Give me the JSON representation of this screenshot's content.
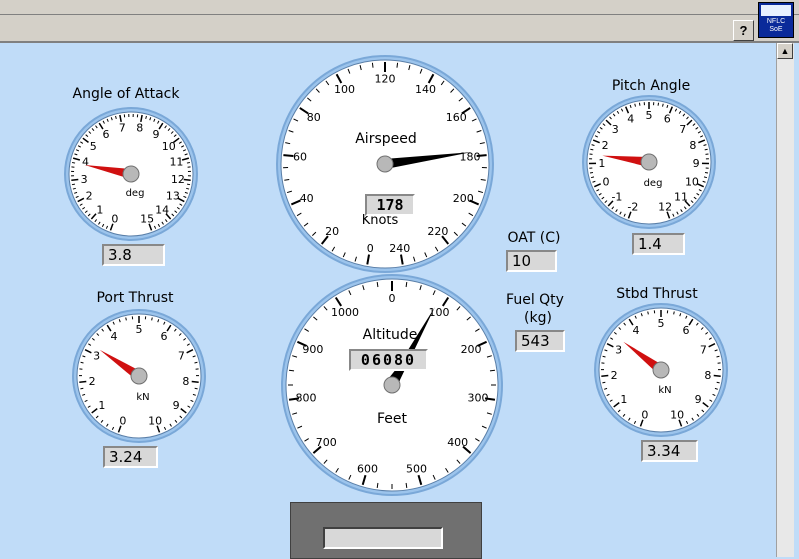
{
  "window": {
    "logo_lines": [
      "NFLC",
      "SoE"
    ],
    "help_label": "?"
  },
  "gauges": {
    "aoa": {
      "title": "Angle of Attack",
      "unit": "deg",
      "value": "3.8",
      "ticks": [
        "0",
        "1",
        "2",
        "3",
        "4",
        "5",
        "6",
        "7",
        "8",
        "9",
        "10",
        "11",
        "12",
        "13",
        "14",
        "15"
      ],
      "reading": 3.8
    },
    "pitch": {
      "title": "Pitch Angle",
      "unit": "deg",
      "value": "1.4",
      "ticks": [
        "-2",
        "-1",
        "0",
        "1",
        "2",
        "3",
        "4",
        "5",
        "6",
        "7",
        "8",
        "9",
        "10",
        "11",
        "12"
      ],
      "reading": 1.4
    },
    "port": {
      "title": "Port Thrust",
      "unit": "kN",
      "value": "3.24",
      "ticks": [
        "0",
        "1",
        "2",
        "3",
        "4",
        "5",
        "6",
        "7",
        "8",
        "9",
        "10"
      ],
      "reading": 3.24
    },
    "stbd": {
      "title": "Stbd Thrust",
      "unit": "kN",
      "value": "3.34",
      "ticks": [
        "0",
        "1",
        "2",
        "3",
        "4",
        "5",
        "6",
        "7",
        "8",
        "9",
        "10"
      ],
      "reading": 3.34
    },
    "airspeed": {
      "title": "Airspeed",
      "unit": "Knots",
      "value": "178",
      "ticks": [
        "0",
        "20",
        "40",
        "60",
        "80",
        "100",
        "120",
        "140",
        "160",
        "180",
        "200",
        "220",
        "240"
      ],
      "reading": 178
    },
    "altitude": {
      "title": "Altitude",
      "unit": "Feet",
      "value": "06080",
      "ticks": [
        "0",
        "100",
        "200",
        "300",
        "400",
        "500",
        "600",
        "700",
        "800",
        "900",
        "1000"
      ],
      "reading": 80
    }
  },
  "readouts": {
    "oat_label": "OAT (C)",
    "oat_value": "10",
    "fuel_label_1": "Fuel Qty",
    "fuel_label_2": "(kg)",
    "fuel_value": "543"
  },
  "colors": {
    "needle_small": "#d01010",
    "needle_large": "#000000",
    "panel": "#c0dcf8"
  }
}
